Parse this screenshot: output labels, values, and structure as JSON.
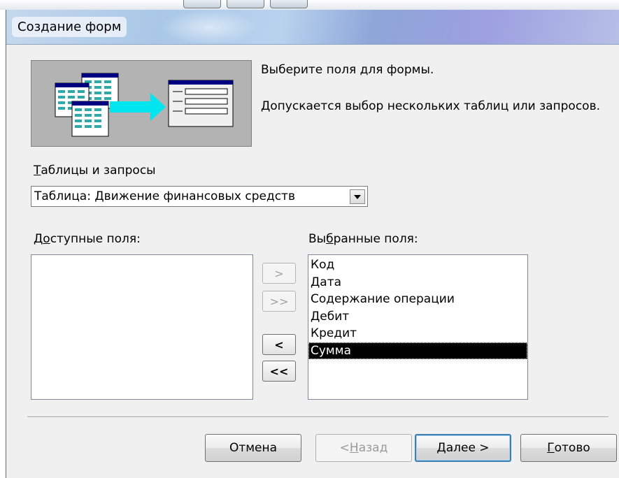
{
  "window": {
    "title": "Создание форм"
  },
  "description": {
    "line1": "Выберите поля для формы.",
    "line2": "Допускается выбор нескольких таблиц или запросов."
  },
  "tables_queries": {
    "label_prefix": "Т",
    "label_rest": "аблицы и запросы",
    "selected_value": "Таблица: Движение финансовых средств"
  },
  "available_fields": {
    "label_prefix": "Д",
    "label_accel": "о",
    "label_rest": "ступные поля:",
    "items": []
  },
  "selected_fields": {
    "label_prefix": "Вы",
    "label_accel": "б",
    "label_rest": "ранные поля:",
    "items": [
      "Код",
      "Дата",
      "Содержание операции",
      "Дебит",
      "Кредит",
      "Сумма"
    ],
    "selected_item": "Сумма"
  },
  "move_buttons": {
    "add_one": ">",
    "add_all": ">>",
    "remove_one": "<",
    "remove_all": "<<"
  },
  "buttons": {
    "cancel": "Отмена",
    "back_prefix": "< ",
    "back_accel": "Н",
    "back_rest": "азад",
    "next_accel": "Д",
    "next_rest": "алее >",
    "finish_accel": "Г",
    "finish_rest": "отово"
  },
  "colors": {
    "selection_bg": "#000000",
    "default_button_border": "#3c7fb1"
  }
}
